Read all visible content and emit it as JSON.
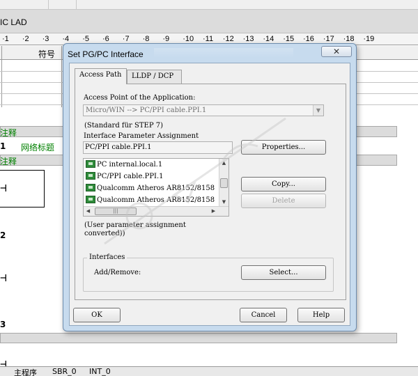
{
  "editor": {
    "title": "IC LAD",
    "ruler_ticks": [
      "1",
      "2",
      "3",
      "4",
      "5",
      "6",
      "7",
      "8",
      "9",
      "10",
      "11",
      "12",
      "13",
      "14",
      "15",
      "16",
      "17",
      "18",
      "19"
    ],
    "symbol_column_header": "符号",
    "network_comment_1": "注释",
    "network_number_1": "1",
    "network_title": "网络标题",
    "network_comment_2": "注释",
    "network_number_2": "2",
    "network_number_3": "3",
    "bottom_tabs": [
      "主程序",
      "SBR_0",
      "INT_0"
    ]
  },
  "dialog": {
    "title": "Set PG/PC Interface",
    "close_label": "✕",
    "tabs": [
      {
        "label": "Access Path",
        "active": true
      },
      {
        "label": "LLDP / DCP",
        "active": false
      }
    ],
    "access_point_label": "Access Point of the Application:",
    "access_point_value": "Micro/WIN      --> PC/PPI cable.PPI.1",
    "access_point_note": "(Standard für STEP 7)",
    "param_assignment_label": "Interface Parameter Assignment",
    "param_assignment_value": "PC/PPI cable.PPI.1",
    "properties_button": "Properties...",
    "copy_button": "Copy...",
    "delete_button": "Delete",
    "interface_list": [
      "PC internal.local.1",
      "PC/PPI cable.PPI.1",
      "Qualcomm Atheros AR8152/8158",
      "Qualcomm Atheros AR8152/8158"
    ],
    "assignment_note_1": "(User parameter assignment",
    "assignment_note_2": "converted))",
    "interfaces_group_label": "Interfaces",
    "add_remove_label": "Add/Remove:",
    "select_button": "Select...",
    "ok_button": "OK",
    "cancel_button": "Cancel",
    "help_button": "Help"
  },
  "colors": {
    "dialog_frame": "#c7dbee",
    "client_bg": "#f0f0f0",
    "network_comment_green": "#008000",
    "interface_icon_green": "#2e8b3a"
  }
}
